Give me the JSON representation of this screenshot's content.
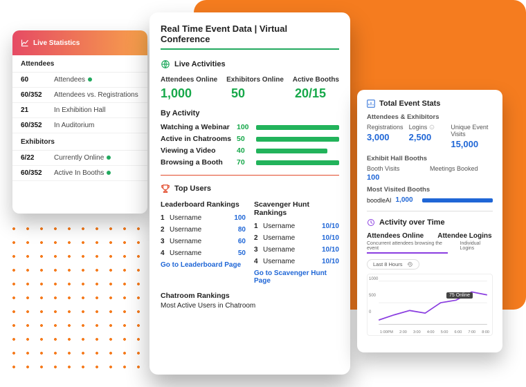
{
  "colors": {
    "orange": "#f57c1f",
    "green": "#22a95f",
    "blue": "#1f66d6",
    "purple": "#8a3de0",
    "red": "#e24a2a"
  },
  "stats": {
    "title": "Live Statistics",
    "attendees": {
      "heading": "Attendees",
      "rows": [
        {
          "value": "60",
          "label": "Attendees",
          "dot": true
        },
        {
          "value": "60/352",
          "label": "Attendees vs. Registrations"
        },
        {
          "value": "21",
          "label": "In Exhibition Hall"
        },
        {
          "value": "60/352",
          "label": "In Auditorium"
        }
      ]
    },
    "exhibitors": {
      "heading": "Exhibitors",
      "rows": [
        {
          "value": "6/22",
          "label": "Currently Online",
          "dot": true
        },
        {
          "value": "60/352",
          "label": "Active In Booths",
          "dot": true
        }
      ]
    }
  },
  "main": {
    "title": "Real Time Event Data | Virtual Conference",
    "live": {
      "heading": "Live Activities",
      "cols": [
        "Attendees Online",
        "Exhibitors Online",
        "Active Booths"
      ],
      "vals": [
        "1,000",
        "50",
        "20/15"
      ]
    },
    "activity": {
      "heading": "By Activity",
      "rows": [
        {
          "label": "Watching a Webinar",
          "value": "100",
          "pct": 100
        },
        {
          "label": "Active in Chatrooms",
          "value": "50",
          "pct": 50
        },
        {
          "label": "Viewing a Video",
          "value": "40",
          "pct": 40
        },
        {
          "label": "Browsing a Booth",
          "value": "70",
          "pct": 70
        }
      ]
    },
    "users": {
      "heading": "Top Users",
      "leaderboard": {
        "title": "Leaderboard Rankings",
        "rows": [
          {
            "n": "1",
            "user": "Username",
            "score": "100"
          },
          {
            "n": "2",
            "user": "Username",
            "score": "80"
          },
          {
            "n": "3",
            "user": "Username",
            "score": "60"
          },
          {
            "n": "4",
            "user": "Username",
            "score": "50"
          }
        ],
        "link": "Go to Leaderboard Page"
      },
      "scavenger": {
        "title": "Scavenger Hunt Rankings",
        "rows": [
          {
            "n": "1",
            "user": "Username",
            "score": "10/10"
          },
          {
            "n": "2",
            "user": "Username",
            "score": "10/10"
          },
          {
            "n": "3",
            "user": "Username",
            "score": "10/10"
          },
          {
            "n": "4",
            "user": "Username",
            "score": "10/10"
          }
        ],
        "link": "Go to Scavenger Hunt Page"
      },
      "chat": {
        "title": "Chatroom Rankings",
        "sub": "Most Active Users in Chatroom"
      }
    }
  },
  "right": {
    "heading": "Total Event Stats",
    "ae": {
      "title": "Attendees & Exhibitors",
      "cells": [
        {
          "label": "Registrations",
          "value": "3,000"
        },
        {
          "label": "Logins",
          "value": "2,500",
          "info": true
        },
        {
          "label": "Unique Event Visits",
          "value": "15,000"
        }
      ]
    },
    "exhibit": {
      "title": "Exhibit Hall Booths",
      "cells": [
        {
          "label": "Booth Visits",
          "value": "100"
        },
        {
          "label": "Meetings Booked",
          "value": ""
        }
      ],
      "most": {
        "label": "Most Visited Booths",
        "name": "boodleAI",
        "value": "1,000"
      }
    },
    "activity": {
      "heading": "Activity over Time",
      "tabs": [
        "Attendees Online",
        "Attendee Logins"
      ],
      "subs": [
        "Concurrent attendees browsing the event",
        "Individual Logins"
      ],
      "pill": "Last 8 Hours",
      "badge": "75 Online"
    }
  },
  "chart_data": {
    "type": "line",
    "title": "Activity over Time",
    "ylabel": "",
    "xlabel": "",
    "x": [
      "1:00PM",
      "2:00",
      "3:00",
      "4:00",
      "5:00",
      "6:00",
      "7:00",
      "8:00"
    ],
    "y_ticks": [
      "1000",
      "500",
      "0"
    ],
    "values": [
      100,
      220,
      320,
      260,
      500,
      560,
      750,
      680
    ],
    "ylim": [
      0,
      1000
    ]
  }
}
